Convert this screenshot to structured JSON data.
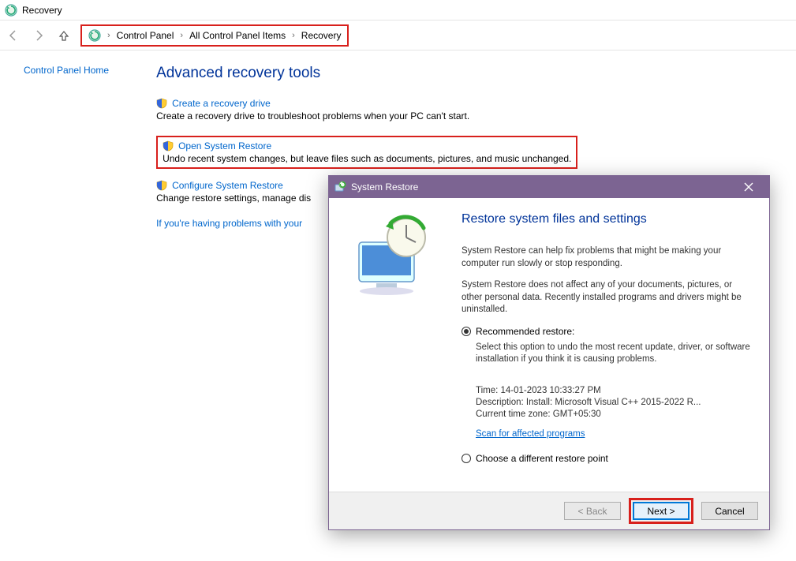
{
  "window": {
    "title": "Recovery"
  },
  "breadcrumb": {
    "items": [
      "Control Panel",
      "All Control Panel Items",
      "Recovery"
    ]
  },
  "sidebar": {
    "home": "Control Panel Home"
  },
  "heading": "Advanced recovery tools",
  "tools": [
    {
      "link": "Create a recovery drive",
      "desc": "Create a recovery drive to troubleshoot problems when your PC can't start."
    },
    {
      "link": "Open System Restore",
      "desc": "Undo recent system changes, but leave files such as documents, pictures, and music unchanged."
    },
    {
      "link": "Configure System Restore",
      "desc": "Change restore settings, manage dis"
    }
  ],
  "help_link": "If you're having problems with your",
  "dialog": {
    "title": "System Restore",
    "heading": "Restore system files and settings",
    "p1": "System Restore can help fix problems that might be making your computer run slowly or stop responding.",
    "p2": "System Restore does not affect any of your documents, pictures, or other personal data. Recently installed programs and drivers might be uninstalled.",
    "radio1": "Recommended restore:",
    "radio1_desc": "Select this option to undo the most recent update, driver, or software installation if you think it is causing problems.",
    "meta_time": "Time: 14-01-2023 10:33:27 PM",
    "meta_desc": "Description: Install: Microsoft Visual C++ 2015-2022 R...",
    "meta_tz": "Current time zone: GMT+05:30",
    "scan_link": "Scan for affected programs",
    "radio2": "Choose a different restore point",
    "btn_back": "< Back",
    "btn_next": "Next >",
    "btn_cancel": "Cancel"
  }
}
